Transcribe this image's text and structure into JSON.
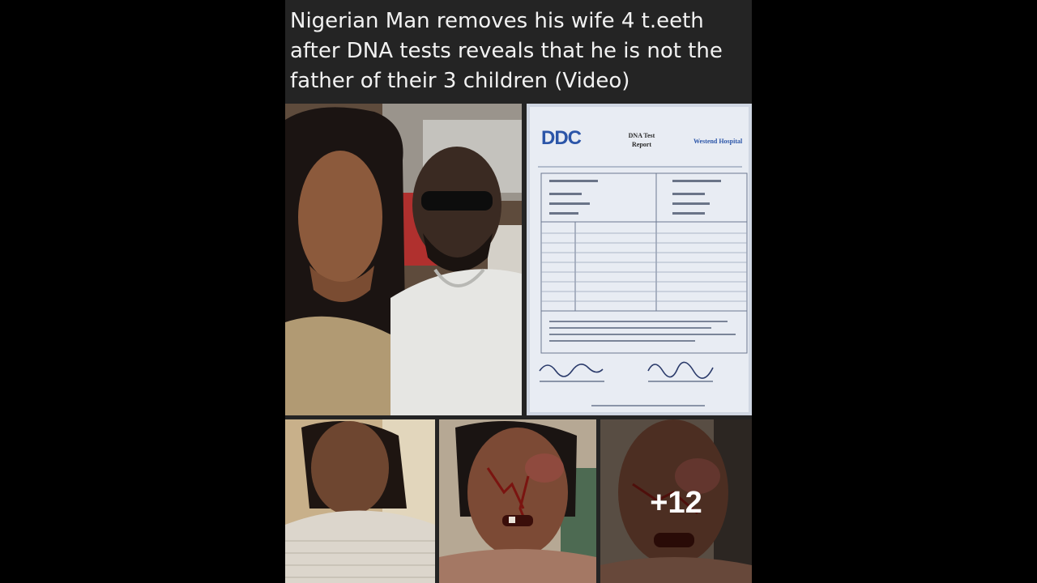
{
  "post": {
    "title": "Nigerian Man removes his wife 4 t.eeth after DNA tests reveals that he is not the father of their 3 children (Video)",
    "more_photos_count": "+12"
  },
  "report": {
    "logo": "DDC",
    "title": "DNA Test Report",
    "hospital": "Westend Hospital"
  },
  "colors": {
    "background": "#000000",
    "post_background": "#242424",
    "title_text": "#f2f2f2",
    "report_logo": "#2b55a8"
  }
}
